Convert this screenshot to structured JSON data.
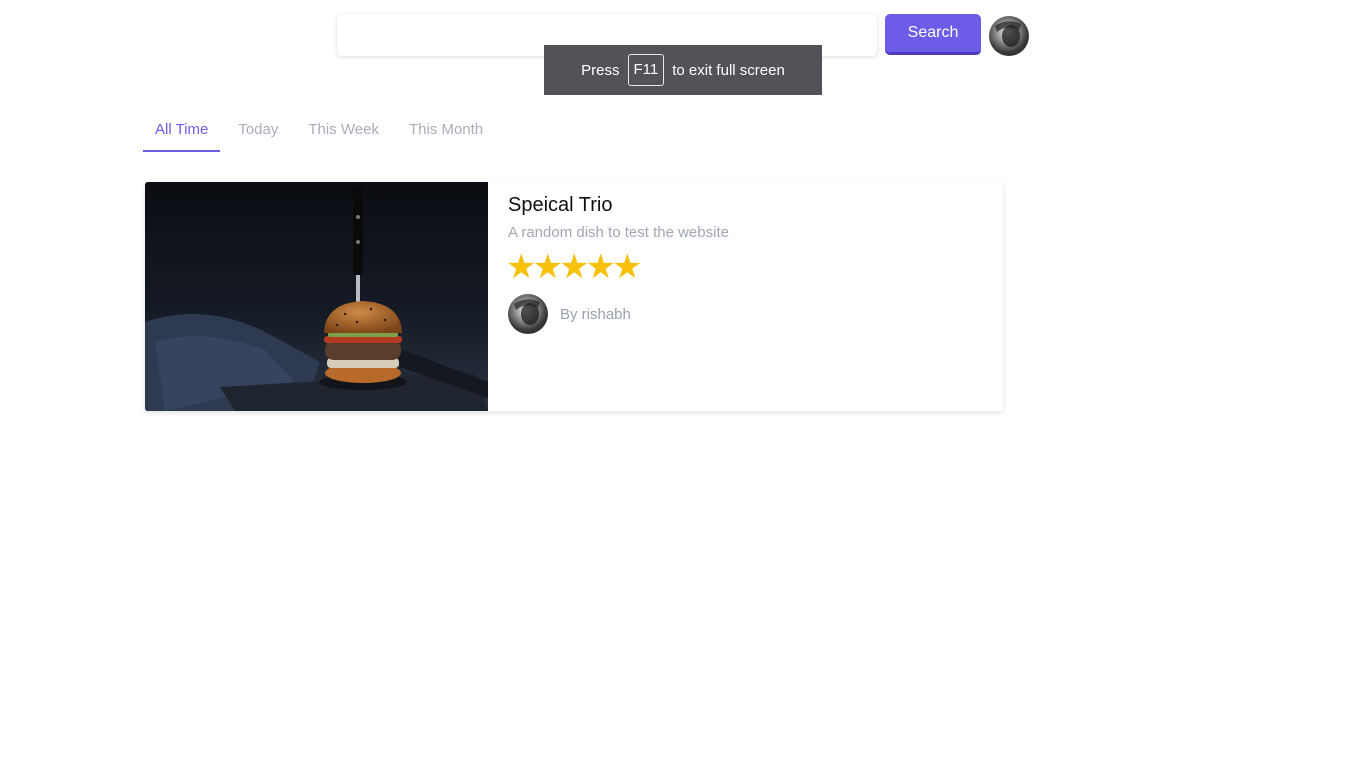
{
  "search": {
    "placeholder": "",
    "value": "",
    "button_label": "Search"
  },
  "fullscreen_toast": {
    "before": "Press",
    "key": "F11",
    "after": "to exit full screen"
  },
  "tabs": [
    {
      "label": "All Time",
      "active": true
    },
    {
      "label": "Today",
      "active": false
    },
    {
      "label": "This Week",
      "active": false
    },
    {
      "label": "This Month",
      "active": false
    }
  ],
  "recipe": {
    "title": "Speical Trio",
    "description": "A random dish to test the website",
    "rating": 5,
    "rating_max": 5,
    "star_glyph": "★",
    "author": "By rishabh"
  },
  "colors": {
    "accent": "#6c5ce7",
    "star": "#f7c00a",
    "muted_text": "#a0a7b3"
  }
}
